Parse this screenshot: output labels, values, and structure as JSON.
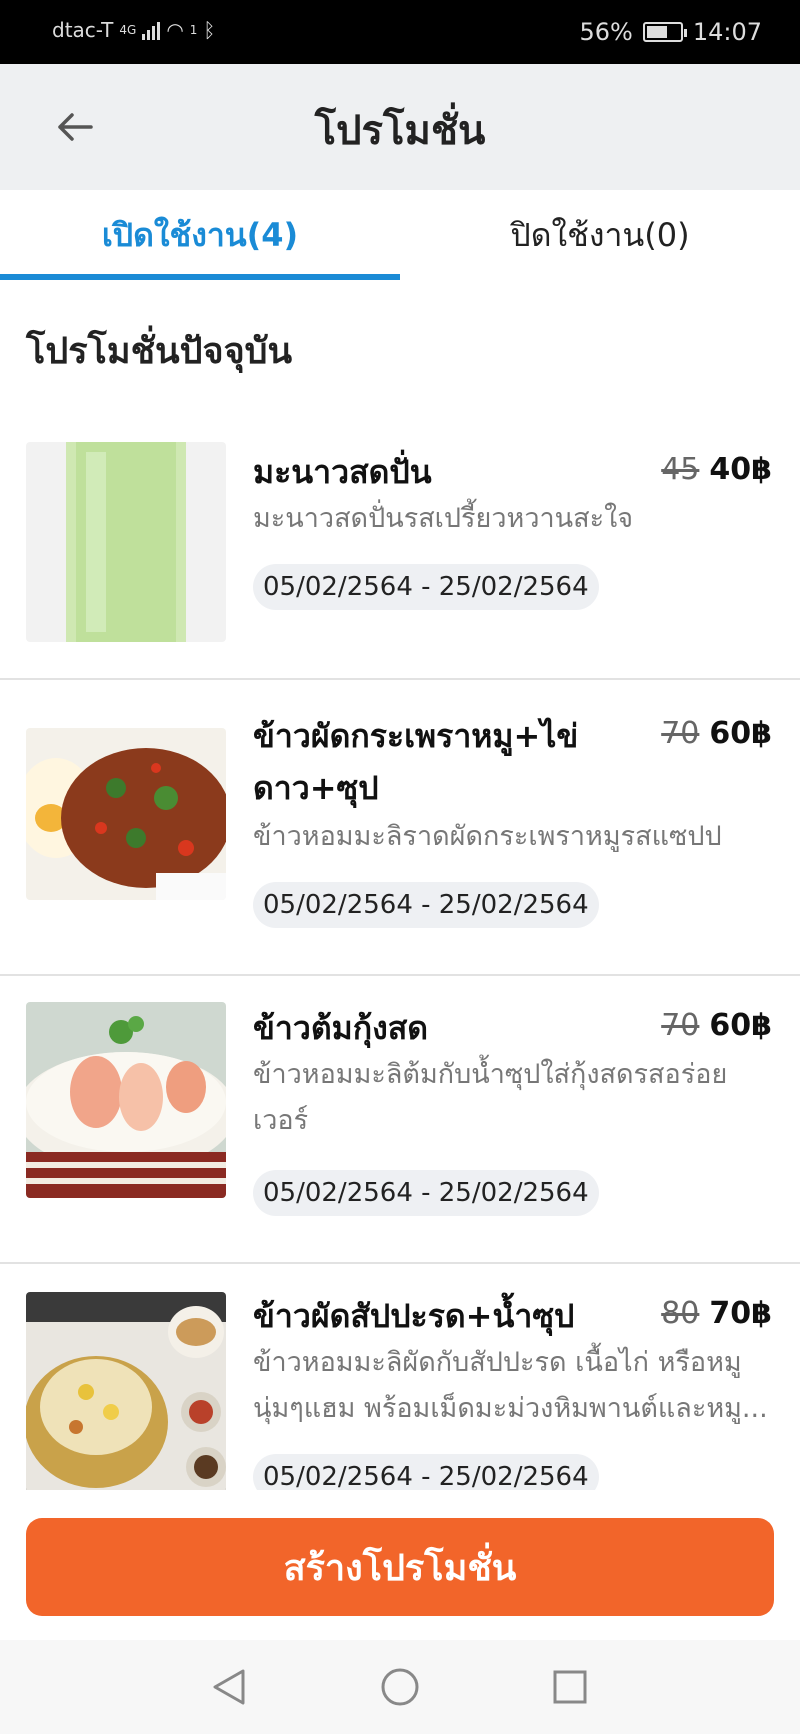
{
  "status_bar": {
    "carrier": "dtac-T",
    "network": "4G",
    "sim": "1",
    "battery": "56%",
    "battery_level": 0.56,
    "time": "14:07"
  },
  "header": {
    "title": "โปรโมชั่น",
    "back_icon": "back-arrow-icon"
  },
  "tabs": [
    {
      "label": "เปิดใช้งาน(4)",
      "active": true
    },
    {
      "label": "ปิดใช้งาน(0)",
      "active": false
    }
  ],
  "section_title": "โปรโมชั่นปัจจุบัน",
  "promotions": [
    {
      "name": "มะนาวสดปั่น",
      "old_price": "45",
      "new_price": "40฿",
      "description": "มะนาวสดปั่นรสเปรี้ยวหวานสะใจ",
      "date_range": "05/02/2564 - 25/02/2564"
    },
    {
      "name": "ข้าวผัดกระเพราหมู+ไข่ดาว+ซุป",
      "old_price": "70",
      "new_price": "60฿",
      "description": "ข้าวหอมมะลิราดผัดกระเพราหมูรสแซปป",
      "date_range": "05/02/2564 - 25/02/2564"
    },
    {
      "name": "ข้าวต้มกุ้งสด",
      "old_price": "70",
      "new_price": "60฿",
      "description": "ข้าวหอมมะลิต้มกับน้ำซุปใส่กุ้งสดรสอร่อยเวอร์",
      "date_range": "05/02/2564 - 25/02/2564"
    },
    {
      "name": "ข้าวผัดสัปปะรด+น้ำซุป",
      "old_price": "80",
      "new_price": "70฿",
      "description": "ข้าวหอมมะลิผัดกับสัปปะรด เนื้อไก่ หรือหมู นุ่มๆแฮม พร้อมเม็ดมะม่วงหิมพานต์และหมู...",
      "date_range": "05/02/2564 - 25/02/2564"
    }
  ],
  "create_button": "สร้างโปรโมชั่น",
  "colors": {
    "accent": "#1a8bd6",
    "cta": "#f2652a",
    "header_bg": "#eef0f2"
  }
}
